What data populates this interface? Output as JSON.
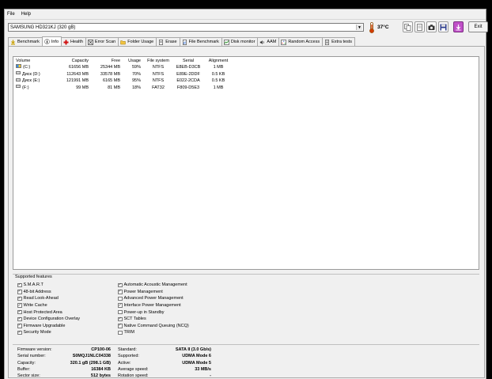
{
  "menu": {
    "file": "File",
    "help": "Help"
  },
  "drive": {
    "selected": "SAMSUNG HD321KJ (320 gB)"
  },
  "temperature": "37°C",
  "toolbar": {
    "exit_label": "Exit"
  },
  "tabs": [
    {
      "label": "Benchmark",
      "icon": "benchmark-icon"
    },
    {
      "label": "Info",
      "icon": "info-icon"
    },
    {
      "label": "Health",
      "icon": "health-icon"
    },
    {
      "label": "Error Scan",
      "icon": "error-scan-icon"
    },
    {
      "label": "Folder Usage",
      "icon": "folder-icon"
    },
    {
      "label": "Erase",
      "icon": "erase-icon"
    },
    {
      "label": "File Benchmark",
      "icon": "file-benchmark-icon"
    },
    {
      "label": "Disk monitor",
      "icon": "disk-monitor-icon"
    },
    {
      "label": "AAM",
      "icon": "aam-icon"
    },
    {
      "label": "Random Access",
      "icon": "random-access-icon"
    },
    {
      "label": "Extra tests",
      "icon": "extra-tests-icon"
    }
  ],
  "volumes": {
    "headers": [
      "Volume",
      "Capacity",
      "Free",
      "Usage",
      "File system",
      "Serial",
      "Alignment"
    ],
    "rows": [
      {
        "volume": "(C:)",
        "capacity": "61656 MB",
        "free": "25344 MB",
        "usage": "59%",
        "fs": "NTFS",
        "serial": "E8EB-D3CB",
        "alignment": "1 MB"
      },
      {
        "volume": "Диск (D:)",
        "capacity": "112643 MB",
        "free": "33578 MB",
        "usage": "70%",
        "fs": "NTFS",
        "serial": "E89E-2DDF",
        "alignment": "0.5 KB"
      },
      {
        "volume": "Диск (E:)",
        "capacity": "121991 MB",
        "free": "6165 MB",
        "usage": "95%",
        "fs": "NTFS",
        "serial": "E022-2CDA",
        "alignment": "0.5 KB"
      },
      {
        "volume": "(F:)",
        "capacity": "99 MB",
        "free": "81 MB",
        "usage": "18%",
        "fs": "FAT32",
        "serial": "F809-D5E3",
        "alignment": "1 MB"
      }
    ]
  },
  "features": {
    "legend": "Supported features",
    "left": [
      {
        "label": "S.M.A.R.T",
        "checked": true
      },
      {
        "label": "48-bit Address",
        "checked": true
      },
      {
        "label": "Read Look-Ahead",
        "checked": true
      },
      {
        "label": "Write Cache",
        "checked": true
      },
      {
        "label": "Host Protected Area",
        "checked": true
      },
      {
        "label": "Device Configuration Overlay",
        "checked": true
      },
      {
        "label": "Firmware Upgradable",
        "checked": true
      },
      {
        "label": "Security Mode",
        "checked": true
      }
    ],
    "right": [
      {
        "label": "Automatic Acoustic Management",
        "checked": true
      },
      {
        "label": "Power Management",
        "checked": true
      },
      {
        "label": "Advanced Power Management",
        "checked": false
      },
      {
        "label": "Interface Power Management",
        "checked": true
      },
      {
        "label": "Power-up in Standby",
        "checked": false
      },
      {
        "label": "SCT Tables",
        "checked": true
      },
      {
        "label": "Native Command Queuing (NCQ)",
        "checked": true
      },
      {
        "label": "TRIM",
        "checked": false
      }
    ]
  },
  "info": {
    "left": [
      {
        "label": "Firmware version:",
        "value": "CP100-06"
      },
      {
        "label": "Serial number:",
        "value": "S0MQJ1NLC04338"
      },
      {
        "label": "Capacity:",
        "value": "320.1 gB (298.1 GB)"
      },
      {
        "label": "Buffer:",
        "value": "16384 KB"
      },
      {
        "label": "Sector size:",
        "value": "512 bytes"
      }
    ],
    "right": [
      {
        "label": "Standard:",
        "value": "SATA II (3.0 Gb/s)"
      },
      {
        "label": "Supported:",
        "value": "UDMA Mode 6"
      },
      {
        "label": "Active:",
        "value": "UDMA Mode 5"
      },
      {
        "label": "Average speed:",
        "value": "33 MB/s"
      },
      {
        "label": "Rotation speed:",
        "value": "-"
      }
    ]
  }
}
